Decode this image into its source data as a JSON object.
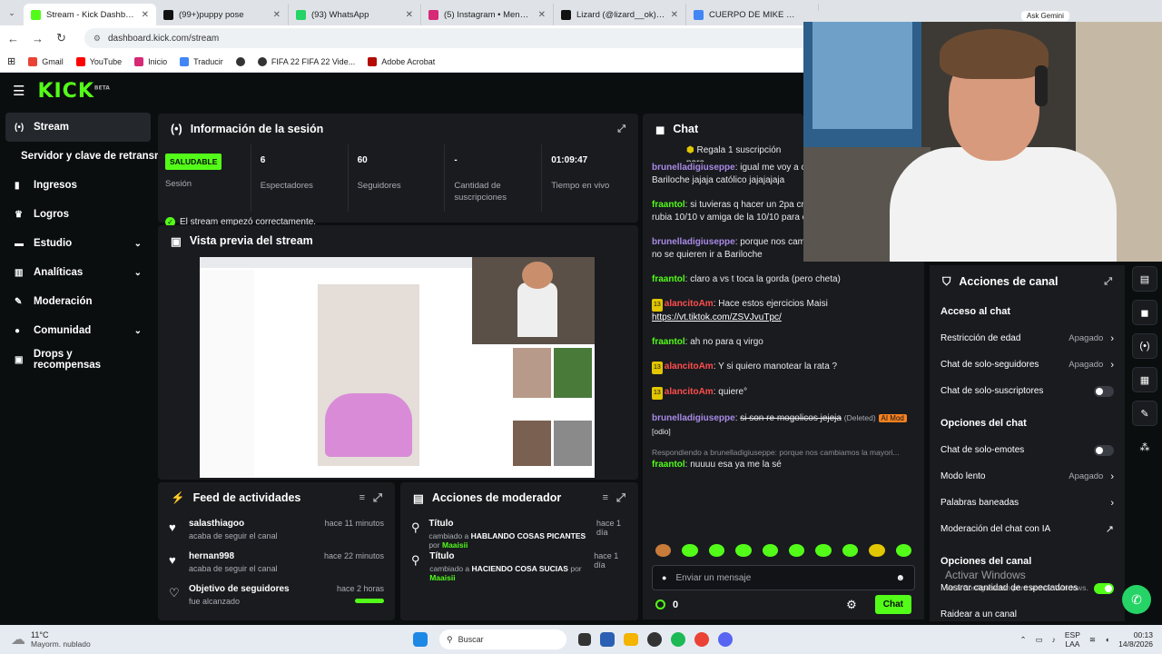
{
  "browser": {
    "tabs": [
      {
        "title": "Stream - Kick Dashboard",
        "color": "#53fc18",
        "active": true
      },
      {
        "title": "(99+)puppy pose",
        "color": "#111111"
      },
      {
        "title": "(93) WhatsApp",
        "color": "#25d366"
      },
      {
        "title": "(5) Instagram • Mensajes",
        "color": "#d62976"
      },
      {
        "title": "Lizard (@lizard__ok) | TikTok",
        "color": "#111111"
      },
      {
        "title": "CUERPO DE MIKE MEM - B",
        "color": "#4285f4"
      }
    ],
    "url": "dashboard.kick.com/stream",
    "bookmarks": [
      "Gmail",
      "YouTube",
      "Inicio",
      "Traducir",
      "",
      "FIFA 22 FIFA 22 Vide...",
      "Adobe Acrobat"
    ],
    "extra_tab_label": "Ask Gemini"
  },
  "kick": {
    "logo": "KICK",
    "logo_sup": "BETA"
  },
  "sidebar": {
    "items": [
      {
        "label": "Stream",
        "icon": "broadcast-icon"
      },
      {
        "label": "Servidor y clave de retransm",
        "icon": ""
      },
      {
        "label": "Ingresos",
        "icon": "chart-icon"
      },
      {
        "label": "Logros",
        "icon": "trophy-icon"
      },
      {
        "label": "Estudio",
        "icon": "studio-icon"
      },
      {
        "label": "Analíticas",
        "icon": "analytics-icon"
      },
      {
        "label": "Moderación",
        "icon": "wrench-icon"
      },
      {
        "label": "Comunidad",
        "icon": "community-icon"
      },
      {
        "label": "Drops y recompensas",
        "icon": "gift-icon"
      }
    ]
  },
  "session": {
    "title": "Información de la sesión",
    "status": "SALUDABLE",
    "status_label": "Sesión",
    "stats": [
      {
        "value": "6",
        "label": "Espectadores"
      },
      {
        "value": "60",
        "label": "Seguidores"
      },
      {
        "value": "-",
        "label": "Cantidad de suscripciones"
      },
      {
        "value": "01:09:47",
        "label": "Tiempo en vivo"
      }
    ],
    "ok_message": "El stream empezó correctamente."
  },
  "preview": {
    "title": "Vista previa del stream"
  },
  "feed": {
    "title": "Feed de actividades",
    "items": [
      {
        "name": "salasthiagoo",
        "text": "acaba de seguir el canal",
        "time": "hace 11 minutos"
      },
      {
        "name": "hernan998",
        "text": "acaba de seguir el canal",
        "time": "hace 22 minutos"
      },
      {
        "name": "Objetivo de seguidores",
        "text": "fue alcanzado",
        "time": "hace 2 horas"
      }
    ]
  },
  "modactions": {
    "title": "Acciones de moderador",
    "items": [
      {
        "label": "Título",
        "pre": "cambiado a",
        "value": "HABLANDO COSAS PICANTES",
        "by": "por",
        "user": "Maaisii",
        "time": "hace 1 día"
      },
      {
        "label": "Título",
        "pre": "cambiado a",
        "value": "HACIENDO COSA SUCIAS",
        "by": "por",
        "user": "Maaisii",
        "time": "hace 1 día"
      }
    ]
  },
  "chat": {
    "title": "Chat",
    "gift": "Regala 1 suscripción para",
    "messages": [
      {
        "user": "brunelladigiuseppe",
        "text": "igual me voy a ca por el tema del viaje a Bariloche jajaja católico jajajajaja"
      },
      {
        "user": "fraantol",
        "text": "si tuvieras q hacer un 2pa cr ejemplo, si a él le toca la rubia 10/10 v amiga de la 10/10 para el 2pa?"
      },
      {
        "user": "brunelladigiuseppe",
        "text": "porque nos cambiamos la mayoria porque no se quieren ir a Bariloche"
      },
      {
        "user": "fraantol",
        "text": "claro a vs t toca la gorda (pero cheta)"
      },
      {
        "user": "alancitoAm",
        "text": "Hace estos ejercicios Maisi",
        "link": "https://vt.tiktok.com/ZSVJvuTpc/"
      },
      {
        "user": "fraantol",
        "text": "ah no para q virgo"
      },
      {
        "user": "alancitoAm",
        "text": "Y si quiero manotear la rata ?"
      },
      {
        "user": "alancitoAm",
        "text": "quiere°"
      },
      {
        "user": "brunelladigiuseppe",
        "text": "si son re mogolicos jejeja",
        "deleted": "(Deleted)",
        "mod": "AI Mod",
        "reason": "[odio]"
      },
      {
        "user": "fraantol",
        "text": "nuuuu esa ya me la sé",
        "reply": "Respondiendo a brunelladigiuseppe: porque nos cambiamos la mayori..."
      }
    ],
    "input_placeholder": "Enviar un mensaje",
    "points": "0",
    "send": "Chat",
    "sub_badge": "13"
  },
  "channel_actions": {
    "title": "Acciones de canal",
    "sections": [
      {
        "heading": "Acceso al chat",
        "rows": [
          {
            "label": "Restricción de edad",
            "value": "Apagado",
            "kind": "chevron"
          },
          {
            "label": "Chat de solo-seguidores",
            "value": "Apagado",
            "kind": "chevron"
          },
          {
            "label": "Chat de solo-suscriptores",
            "value": "",
            "kind": "toggle"
          }
        ]
      },
      {
        "heading": "Opciones del chat",
        "rows": [
          {
            "label": "Chat de solo-emotes",
            "value": "",
            "kind": "toggle"
          },
          {
            "label": "Modo lento",
            "value": "Apagado",
            "kind": "chevron"
          },
          {
            "label": "Palabras baneadas",
            "value": "",
            "kind": "chevron"
          },
          {
            "label": "Moderación del chat con IA",
            "value": "",
            "kind": "external"
          }
        ]
      },
      {
        "heading": "Opciones del canal",
        "rows": [
          {
            "label": "Mostrar cantidad de espectadores",
            "value": "",
            "kind": "toggle-on"
          },
          {
            "label": "Raidear a un canal",
            "value": "",
            "kind": "none"
          }
        ]
      }
    ],
    "watermark": "Activar Windows",
    "watermark_sub": "Ve a Configuración para activar Windows."
  },
  "taskbar": {
    "weather_temp": "11°C",
    "weather_text": "Mayorm. nublado",
    "search": "Buscar",
    "lang": "ESP",
    "lang2": "LAA",
    "time": "00:13",
    "date": "14/8/2026"
  }
}
